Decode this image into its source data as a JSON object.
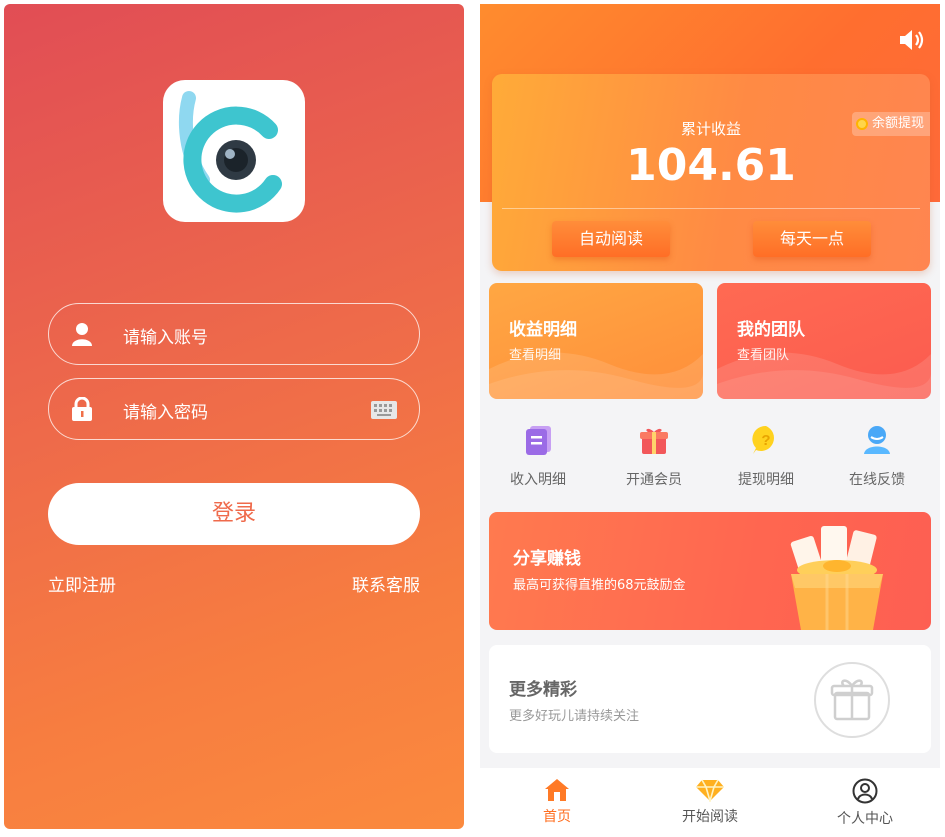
{
  "login": {
    "account_placeholder": "请输入账号",
    "password_placeholder": "请输入密码",
    "login_button": "登录",
    "register_link": "立即注册",
    "contact_link": "联系客服"
  },
  "home": {
    "earnings": {
      "label": "累计收益",
      "value": "104.61",
      "withdraw_label": "余额提现",
      "auto_read_button": "自动阅读",
      "daily_button": "每天一点"
    },
    "tiles": [
      {
        "title": "收益明细",
        "subtitle": "查看明细"
      },
      {
        "title": "我的团队",
        "subtitle": "查看团队"
      }
    ],
    "quick_links": [
      {
        "label": "收入明细",
        "icon": "document-icon"
      },
      {
        "label": "开通会员",
        "icon": "gift-icon"
      },
      {
        "label": "提现明细",
        "icon": "question-icon"
      },
      {
        "label": "在线反馈",
        "icon": "support-agent-icon"
      }
    ],
    "share": {
      "title": "分享赚钱",
      "subtitle": "最高可获得直推的68元鼓励金"
    },
    "more": {
      "title": "更多精彩",
      "subtitle": "更多好玩儿请持续关注"
    },
    "tabbar": [
      {
        "label": "首页",
        "icon": "home-icon",
        "active": true
      },
      {
        "label": "开始阅读",
        "icon": "diamond-icon",
        "active": false
      },
      {
        "label": "个人中心",
        "icon": "user-circle-icon",
        "active": false
      }
    ]
  },
  "colors": {
    "accent_orange": "#ff6f21",
    "login_gradient_start": "#e14d55",
    "login_gradient_end": "#fb8a3e"
  }
}
